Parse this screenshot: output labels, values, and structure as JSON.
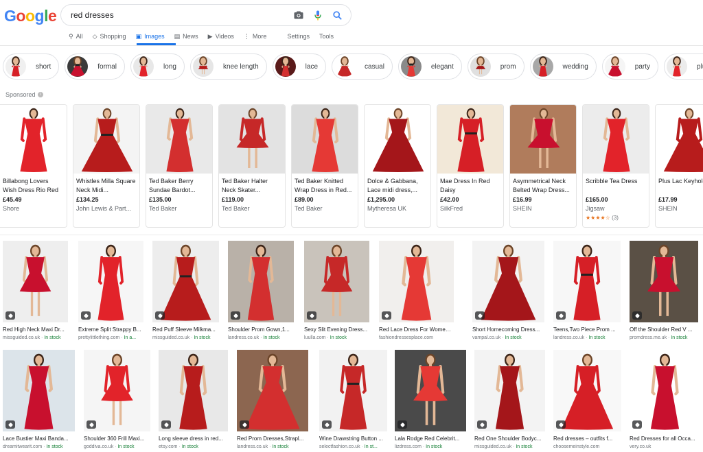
{
  "logo": [
    "G",
    "o",
    "o",
    "g",
    "l",
    "e"
  ],
  "logo_colors": [
    "#4285F4",
    "#EA4335",
    "#FBBC05",
    "#4285F4",
    "#34A853",
    "#EA4335"
  ],
  "search": {
    "query": "red dresses"
  },
  "tabs": [
    {
      "label": "All",
      "icon": "search-icon",
      "glyph": "⚲"
    },
    {
      "label": "Shopping",
      "icon": "tag-icon",
      "glyph": "◇"
    },
    {
      "label": "Images",
      "icon": "image-icon",
      "glyph": "▣",
      "active": true
    },
    {
      "label": "News",
      "icon": "news-icon",
      "glyph": "▤"
    },
    {
      "label": "Videos",
      "icon": "video-icon",
      "glyph": "▶"
    },
    {
      "label": "More",
      "icon": "more-dots-icon",
      "glyph": "⋮"
    },
    {
      "label": "Settings"
    },
    {
      "label": "Tools"
    }
  ],
  "chips": [
    "short",
    "formal",
    "long",
    "knee length",
    "lace",
    "casual",
    "elegant",
    "prom",
    "wedding",
    "party",
    "plus size",
    ""
  ],
  "sponsored_label": "Sponsored",
  "shopping": [
    {
      "title": "Billabong Lovers Wish Dress Rio Red",
      "price": "£45.49",
      "seller": "Shore",
      "bg": "#ffffff"
    },
    {
      "title": "Whistles Milla Square Neck Midi...",
      "price": "£134.25",
      "seller": "John Lewis & Part...",
      "bg": "#f4f4f4"
    },
    {
      "title": "Ted Baker Berry Sundae Bardot...",
      "price": "£135.00",
      "seller": "Ted Baker",
      "bg": "#e9e9e9"
    },
    {
      "title": "Ted Baker Halter Neck Skater...",
      "price": "£119.00",
      "seller": "Ted Baker",
      "bg": "#e3e3e3"
    },
    {
      "title": "Ted Baker Knitted Wrap Dress in Red...",
      "price": "£89.00",
      "seller": "Ted Baker",
      "bg": "#dcdcdc"
    },
    {
      "title": "Dolce & Gabbana, Lace midi dress,...",
      "price": "£1,295.00",
      "seller": "Mytheresa UK",
      "bg": "#ffffff"
    },
    {
      "title": "Mae Dress In Red Daisy",
      "price": "£42.00",
      "seller": "SilkFred",
      "bg": "#f2e8d8"
    },
    {
      "title": "Asymmetrical Neck Belted Wrap Dress...",
      "price": "£16.99",
      "seller": "SHEIN",
      "bg": "#b07c5c"
    },
    {
      "title": "Scribble Tea Dress",
      "price": "£165.00",
      "seller": "Jigsaw",
      "stars": "★★★★☆",
      "rating_count": "(3)",
      "bg": "#ececec"
    },
    {
      "title": "Plus Lac Keyhole",
      "price": "£17.99",
      "seller": "SHEIN",
      "bg": "#ffffff"
    }
  ],
  "images_row1": [
    {
      "title": "Red High Neck Maxi Dr...",
      "source": "missguided.co.uk",
      "stock": "In stock",
      "bg": "#eeeeee"
    },
    {
      "title": "Extreme Split Strappy B...",
      "source": "prettylittlething.com",
      "stock": "In a...",
      "bg": "#f6f6f6"
    },
    {
      "title": "Red Puff Sleeve Milkma...",
      "source": "missguided.co.uk",
      "stock": "In stock",
      "bg": "#ededed"
    },
    {
      "title": "Shoulder Prom Gown,1...",
      "source": "landress.co.uk",
      "stock": "In stock",
      "bg": "#b9b1a8"
    },
    {
      "title": "Sexy Slit Evening Dress...",
      "source": "luulla.com",
      "stock": "In stock",
      "bg": "#c9c3bb"
    },
    {
      "title": "Red Lace Dress For Women Ev...",
      "source": "fashiondressesplace.com",
      "stock": "",
      "bg": "#f1efed"
    },
    {
      "title": "Short Homecoming Dress...",
      "source": "vampal.co.uk",
      "stock": "In stock",
      "bg": "#f3f3f3"
    },
    {
      "title": "Teens,Two Piece Prom ...",
      "source": "landress.co.uk",
      "stock": "In stock",
      "bg": "#f7f7f7"
    },
    {
      "title": "Off the Shoulder Red V ...",
      "source": "promdress.me.uk",
      "stock": "In stock",
      "bg": "#5a5045"
    }
  ],
  "images_row2": [
    {
      "title": "Lace Bustier Maxi Banda...",
      "source": "dreamitwearit.com",
      "stock": "In stock",
      "bg": "#dce4ea"
    },
    {
      "title": "Shoulder 360 Frill Maxi...",
      "source": "goddiva.co.uk",
      "stock": "In stock",
      "bg": "#f5f5f5"
    },
    {
      "title": "Long sleeve dress in red...",
      "source": "etsy.com",
      "stock": "In stock",
      "bg": "#e8e8e8"
    },
    {
      "title": "Red Prom Dresses,Strapl...",
      "source": "landress.co.uk",
      "stock": "In stock",
      "bg": "#8c6650"
    },
    {
      "title": "Wine Drawstring Button ...",
      "source": "selectfashion.co.uk",
      "stock": "In st...",
      "bg": "#f2f2f2"
    },
    {
      "title": "Lala Rodge Red Celebrit...",
      "source": "lizdress.com",
      "stock": "In stock",
      "bg": "#4a4a4a"
    },
    {
      "title": "Red One Shoulder Bodyc...",
      "source": "missguided.co.uk",
      "stock": "In stock",
      "bg": "#f3f3f3"
    },
    {
      "title": "Red dresses – outfits f...",
      "source": "choosemeinstyle.com",
      "stock": "",
      "bg": "#f8f8f8"
    },
    {
      "title": "Red Dresses for all Occa...",
      "source": "very.co.uk",
      "stock": "",
      "bg": "#ffffff"
    }
  ]
}
